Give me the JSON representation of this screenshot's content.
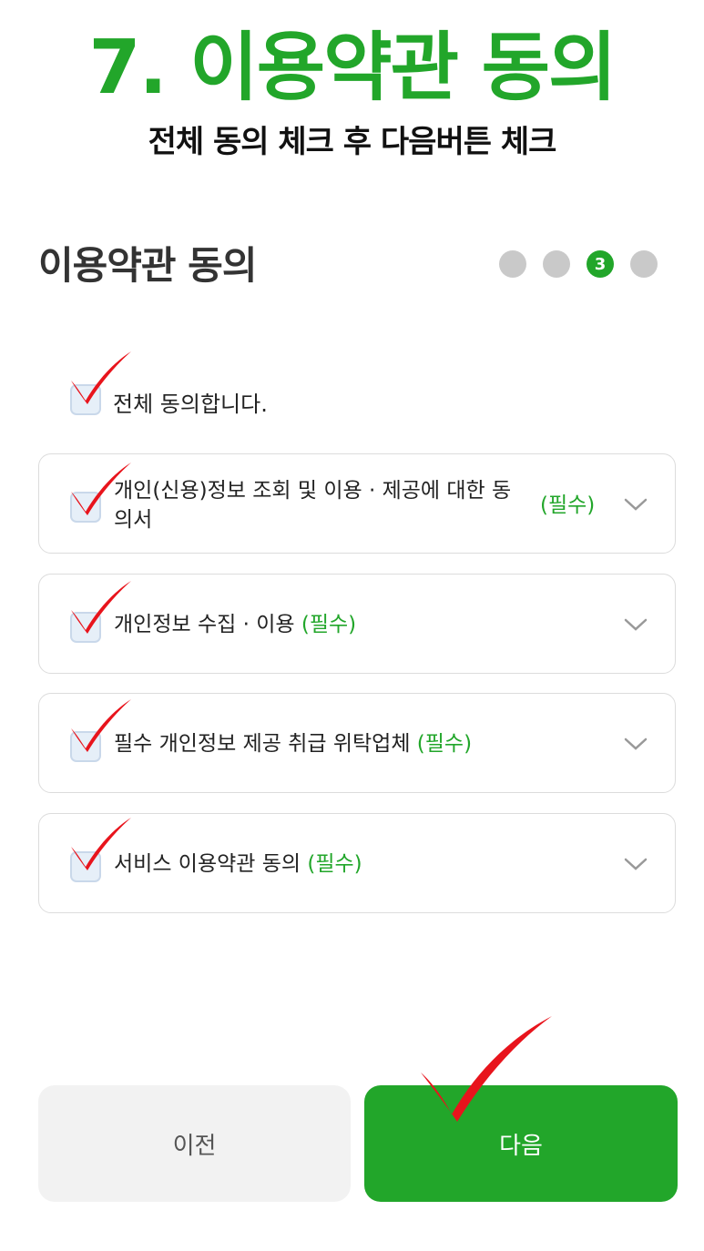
{
  "banner": {
    "title": "7. 이용약관 동의",
    "subtitle": "전체 동의 체크 후 다음버튼 체크"
  },
  "page": {
    "title": "이용약관 동의",
    "current_step": "3"
  },
  "agree_all": {
    "label": "전체 동의합니다."
  },
  "terms": [
    {
      "label_line1": "개인(신용)정보 조회 및 이용 · 제공에 대한 동",
      "label_line2": "의서",
      "required": "(필수)"
    },
    {
      "label": "개인정보 수집 · 이용",
      "required": "(필수)"
    },
    {
      "label": "필수 개인정보 제공 취급 위탁업체",
      "required": "(필수)"
    },
    {
      "label": "서비스 이용약관 동의",
      "required": "(필수)"
    }
  ],
  "buttons": {
    "prev": "이전",
    "next": "다음"
  },
  "colors": {
    "accent": "#22a62a",
    "checkmark": "#e8141c"
  }
}
